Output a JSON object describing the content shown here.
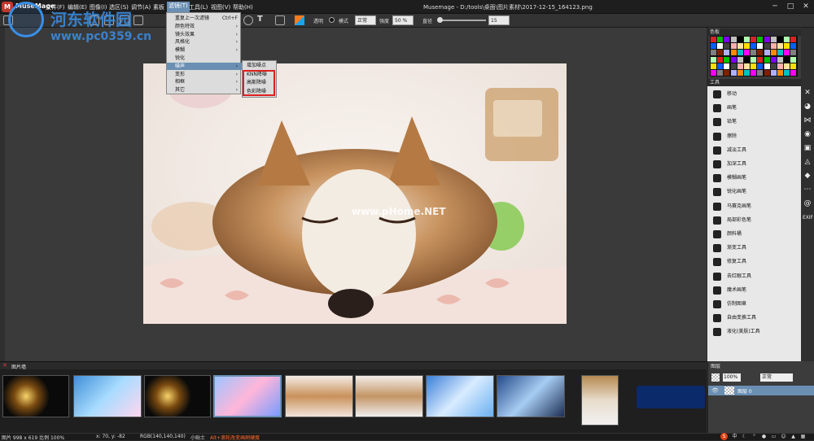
{
  "app": {
    "name": "MuseMage",
    "window_title": "Musemage - D:/tools\\桌面\\图片素材\\2017-12-15_164123.png"
  },
  "menu": {
    "items": [
      "文件(F)",
      "编辑(E)",
      "图像(I)",
      "选区(S)",
      "调节(A)",
      "素板",
      "滤镜(T)",
      "工具(L)",
      "视图(V)",
      "帮助(H)"
    ],
    "active_index": 6
  },
  "toolbar": {
    "opacity_label": "透明",
    "mode_label": "模式",
    "mode_value": "正常",
    "zoom_label": "强度",
    "zoom_value": "50 %",
    "size_label": "直径",
    "size_value": "15"
  },
  "filter_menu": {
    "items": [
      {
        "label": "重复上一次滤镜",
        "shortcut": "Ctrl+F",
        "submenu": false
      },
      {
        "label": "颜色特效",
        "submenu": true
      },
      {
        "label": "镜头效果",
        "submenu": true
      },
      {
        "label": "风格化",
        "submenu": true
      },
      {
        "label": "模糊",
        "submenu": true
      },
      {
        "label": "锐化",
        "submenu": false
      },
      {
        "label": "噪声",
        "submenu": true
      },
      {
        "label": "变形",
        "submenu": true
      },
      {
        "label": "相框",
        "submenu": true
      },
      {
        "label": "其它",
        "submenu": true
      }
    ],
    "highlighted_index": 6
  },
  "noise_submenu": {
    "items": [
      "增加噪点",
      "KNN降噪",
      "高斯降噪",
      "色彩降噪"
    ]
  },
  "watermark": {
    "title": "河东软件园",
    "url": "www.pc0359.cn",
    "center": "www.pHome.NET"
  },
  "panels": {
    "colors_title": "色板",
    "tools_title": "工具",
    "gallery_title": "图片墙",
    "layers_title": "图层"
  },
  "tools": [
    "移动",
    "画笔",
    "铅笔",
    "擦除",
    "减淡工具",
    "加深工具",
    "模糊画笔",
    "锐化画笔",
    "马赛克画笔",
    "局部彩色笔",
    "颜料桶",
    "渐变工具",
    "修复工具",
    "去红眼工具",
    "魔术画笔",
    "仿制图章",
    "自由变换工具",
    "液化(美肤)工具"
  ],
  "side_icons": [
    "cross-tools-icon",
    "palette-icon",
    "butterfly-icon",
    "color-wheel-icon",
    "camera-icon",
    "drops-icon",
    "diamond-icon",
    "more-dots-icon",
    "at-icon"
  ],
  "side_text": "EXIF",
  "layers": {
    "opacity": "100%",
    "mode": "正常",
    "layer_name": "图层 0"
  },
  "status": {
    "image_size": "图片 998 x 619 比例 100%",
    "coords": "x: 70, y: -82",
    "rgb": "RGB(140,140,140)",
    "hint_label": "小贴士",
    "hint_text": "Alt+滚轮改变画刷硬度"
  },
  "colors": {
    "accent": "#6a8fb3",
    "highlight_box": "#e02020"
  }
}
